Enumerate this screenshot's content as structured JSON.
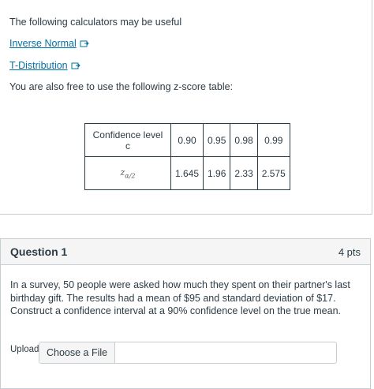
{
  "calculators": {
    "intro": "The following calculators may be useful",
    "links": [
      {
        "label": "Inverse Normal",
        "icon": "external-link-icon"
      },
      {
        "label": "T-Distribution",
        "icon": "external-link-icon"
      }
    ],
    "table_intro": "You are also free to use the following z-score table:"
  },
  "z_table": {
    "row1_label": "Confidence level c",
    "row2_label": "z",
    "row2_sub": "α/2",
    "confidence": [
      "0.90",
      "0.95",
      "0.98",
      "0.99"
    ],
    "z_values": [
      "1.645",
      "1.96",
      "2.33",
      "2.575"
    ]
  },
  "question": {
    "title": "Question 1",
    "points": "4 pts",
    "text": "In a survey, 50 people were asked how much they spent on their partner's last birthday gift. The results had a mean of $95 and standard deviation of $17. Construct a confidence interval at a 90% confidence level on the true mean.",
    "upload_label": "Upload",
    "choose_file": "Choose a File"
  },
  "colors": {
    "link": "#0770a3",
    "text": "#2d3b45",
    "border": "#c7cdd1",
    "header_bg": "#f5f5f5"
  }
}
